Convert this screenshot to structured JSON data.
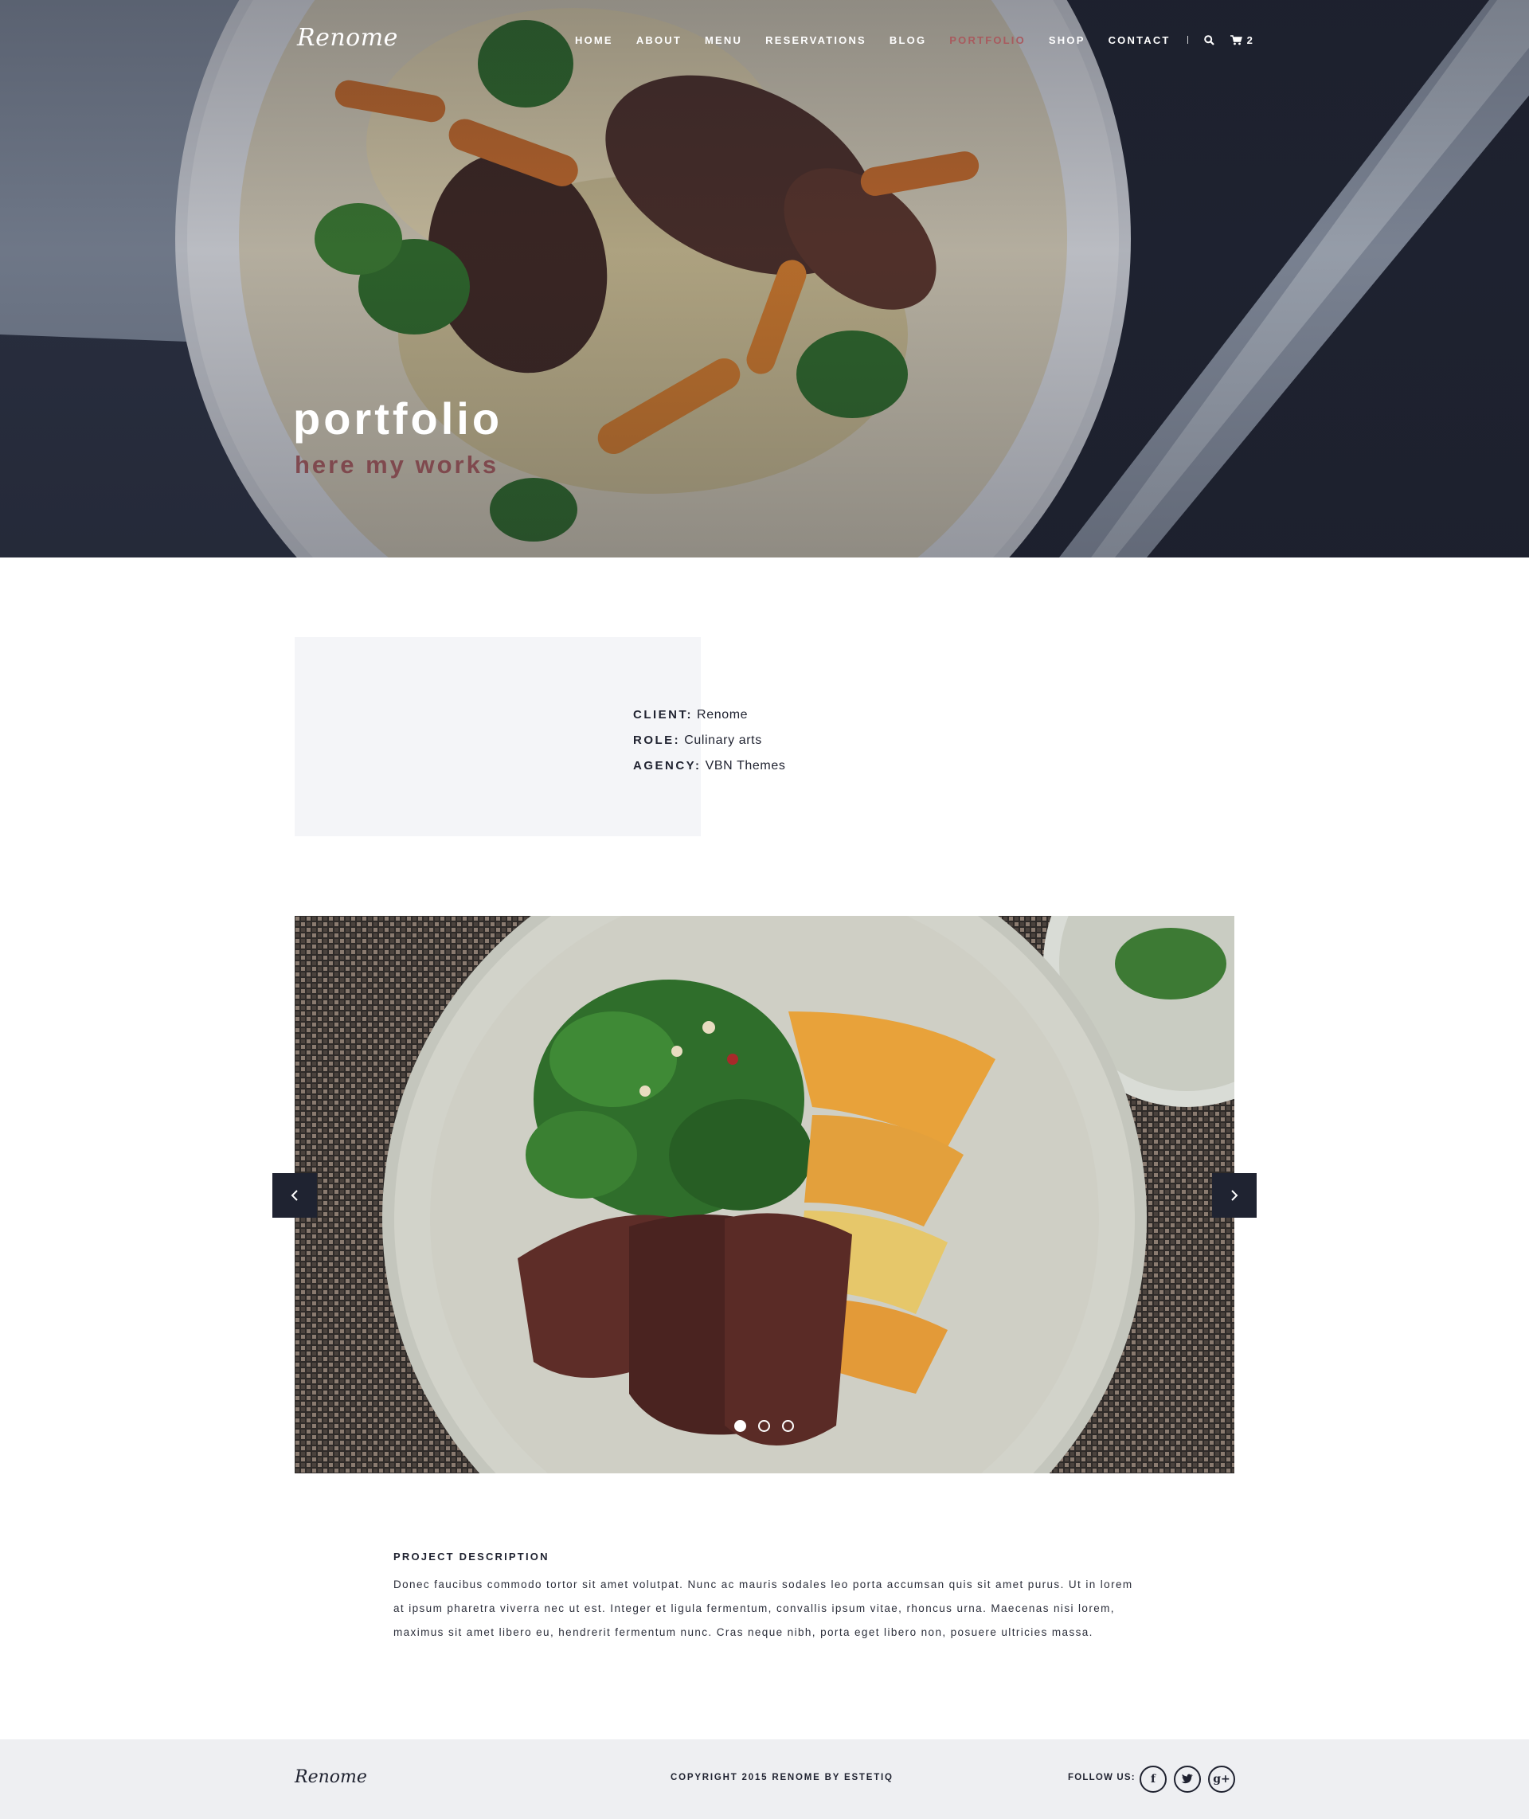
{
  "brand": {
    "logo_text": "Renome"
  },
  "nav": {
    "items": [
      {
        "label": "HOME"
      },
      {
        "label": "ABOUT"
      },
      {
        "label": "MENU"
      },
      {
        "label": "RESERVATIONS"
      },
      {
        "label": "BLOG"
      },
      {
        "label": "PORTFOLIO",
        "active": true
      },
      {
        "label": "SHOP"
      },
      {
        "label": "CONTACT"
      }
    ],
    "cart_count": "2",
    "search_icon": "search-icon",
    "cart_icon": "cart-icon"
  },
  "hero": {
    "title": "portfolio",
    "subtitle": "here my works"
  },
  "project_info": {
    "client_label": "CLIENT:",
    "client_value": "Renome",
    "role_label": "ROLE:",
    "role_value": "Culinary arts",
    "agency_label": "AGENCY:",
    "agency_value": "VBN Themes"
  },
  "slider": {
    "slide_count": 3,
    "active_slide": 1,
    "prev_icon": "chevron-left-icon",
    "next_icon": "chevron-right-icon"
  },
  "description": {
    "title": "PROJECT DESCRIPTION",
    "body": "Donec faucibus commodo tortor sit amet volutpat. Nunc ac mauris sodales leo porta accumsan quis sit amet purus. Ut in lorem at ipsum pharetra viverra nec ut est. Integer et ligula fermentum, convallis ipsum vitae, rhoncus urna. Maecenas nisi lorem, maximus sit amet libero eu, hendrerit fermentum nunc. Cras neque nibh, porta eget libero non, posuere ultricies massa."
  },
  "footer": {
    "logo_text": "Renome",
    "copyright": "COPYRIGHT 2015 RENOME BY ESTETIQ",
    "follow_label": "FOLLOW US:",
    "socials": [
      {
        "icon": "facebook-icon",
        "glyph": "f"
      },
      {
        "icon": "twitter-icon",
        "glyph": "t"
      },
      {
        "icon": "google-plus-icon",
        "glyph": "g+"
      }
    ]
  },
  "colors": {
    "dark": "#1f2331",
    "accent": "#a85a5e",
    "footer_bg": "#eeeff2",
    "info_bg": "#f4f5f8"
  }
}
